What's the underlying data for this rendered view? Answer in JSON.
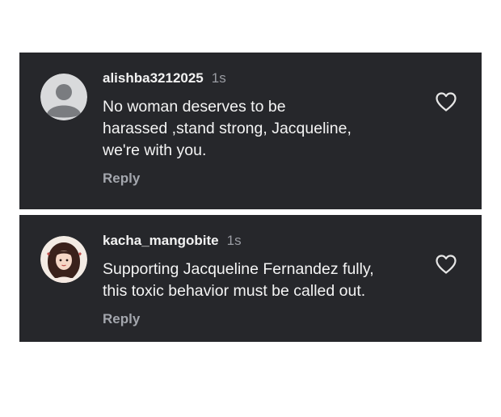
{
  "comments": [
    {
      "username": "alishba3212025",
      "timestamp": "1s",
      "text_lines": [
        "No woman deserves to be",
        "harassed ,stand strong, Jacqueline,",
        "we're with you."
      ],
      "reply_label": "Reply",
      "avatar_icon": "default-user-avatar",
      "like_icon": "heart-outline-icon"
    },
    {
      "username": "kacha_mangobite",
      "timestamp": "1s",
      "text_lines": [
        "Supporting Jacqueline Fernandez fully,",
        "this toxic behavior must be called out."
      ],
      "reply_label": "Reply",
      "avatar_icon": "illustrated-profile-avatar",
      "like_icon": "heart-outline-icon"
    }
  ],
  "colors": {
    "card_background": "#26272b",
    "text_primary": "#f4f4f4",
    "text_secondary": "#9a9ca3"
  }
}
